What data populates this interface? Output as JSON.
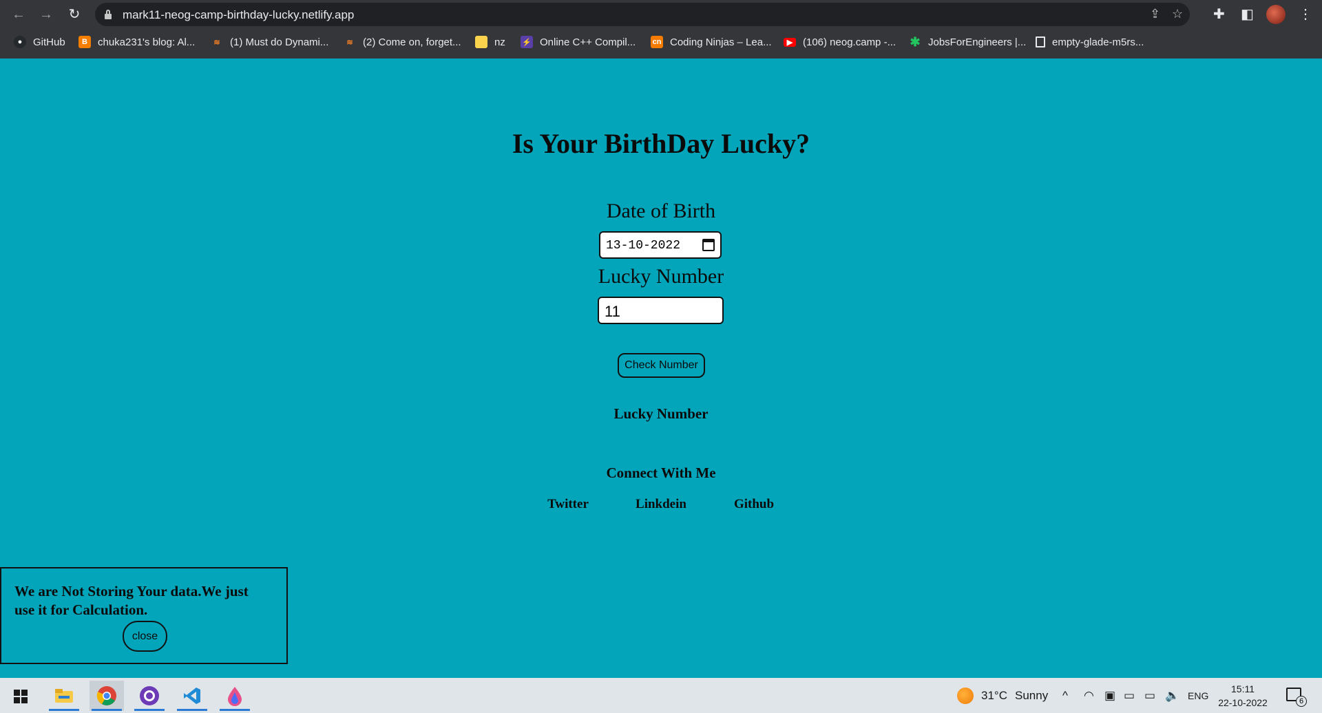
{
  "browser": {
    "url": "mark11-neog-camp-birthday-lucky.netlify.app",
    "bookmarks": [
      {
        "label": "GitHub",
        "color": "#24292e",
        "icon": "github-icon"
      },
      {
        "label": "chuka231's blog: Al...",
        "color": "#f57d00",
        "icon": "blogger-icon"
      },
      {
        "label": "(1) Must do Dynami...",
        "color": "#f48024",
        "icon": "stackoverflow-icon"
      },
      {
        "label": "(2) Come on, forget...",
        "color": "#f48024",
        "icon": "stackoverflow-icon"
      },
      {
        "label": "nz",
        "color": "#fcd34d",
        "icon": "folder-icon"
      },
      {
        "label": "Online C++ Compil...",
        "color": "#5b3fa8",
        "icon": "bolt-icon"
      },
      {
        "label": "Coding Ninjas – Lea...",
        "color": "#f57c00",
        "icon": "codingninjas-icon"
      },
      {
        "label": "(106) neog.camp -...",
        "color": "#ff0000",
        "icon": "youtube-icon"
      },
      {
        "label": "JobsForEngineers |...",
        "color": "#22c55e",
        "icon": "asterisk-icon"
      },
      {
        "label": "empty-glade-m5rs...",
        "color": "#2b2b2b",
        "icon": "page-icon"
      }
    ]
  },
  "page": {
    "title": "Is Your BirthDay Lucky?",
    "dob_label": "Date of Birth",
    "dob_value": "13-10-2022",
    "lucky_label": "Lucky Number",
    "lucky_value": "11",
    "check_button": "Check Number",
    "result_text": "Lucky Number",
    "connect_heading": "Connect With Me",
    "social_links": [
      "Twitter",
      "Linkdein",
      "Github"
    ],
    "notice_text": "We are Not Storing Your data.We just use it for Calculation.",
    "close_button": "close",
    "background_color": "#03a5bb"
  },
  "taskbar": {
    "weather_temp": "31°C",
    "weather_desc": "Sunny",
    "language": "ENG",
    "time": "15:11",
    "date": "22-10-2022",
    "notification_count": "6"
  }
}
